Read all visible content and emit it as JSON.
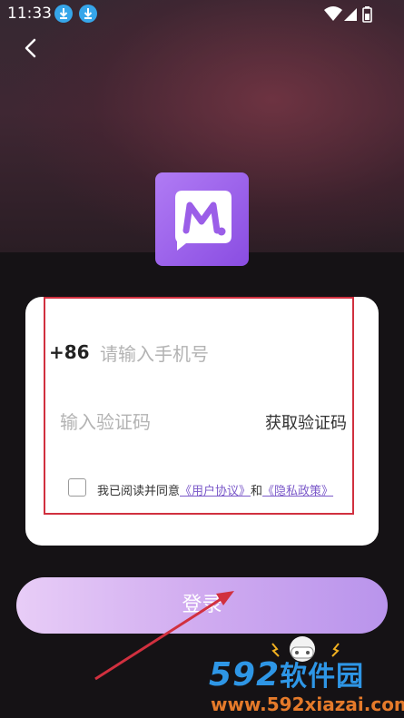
{
  "status_bar": {
    "time": "11:33",
    "icons": [
      "download-icon",
      "download-icon",
      "wifi-icon",
      "signal-icon",
      "battery-icon"
    ]
  },
  "nav": {
    "back_icon": "back-arrow-icon"
  },
  "logo": {
    "icon": "app-logo-m-icon"
  },
  "form": {
    "phone_prefix": "+86",
    "phone_placeholder": "请输入手机号",
    "phone_value": "",
    "code_placeholder": "输入验证码",
    "code_value": "",
    "get_code_label": "获取验证码",
    "agree_checked": false,
    "agree_prefix": "我已阅读并同意",
    "user_agreement": "《用户协议》",
    "agree_and": "和",
    "privacy_policy": "《隐私政策》"
  },
  "login_button_label": "登录",
  "watermark": {
    "brand_num": "592",
    "brand_cn": "软件园",
    "url": "www.592xiazai.com"
  },
  "colors": {
    "accent": "#8a4de2",
    "button_gradient_start": "#e8cdf7",
    "button_gradient_end": "#b994ec",
    "highlight_border": "#d1303f",
    "link": "#7b59c9"
  }
}
